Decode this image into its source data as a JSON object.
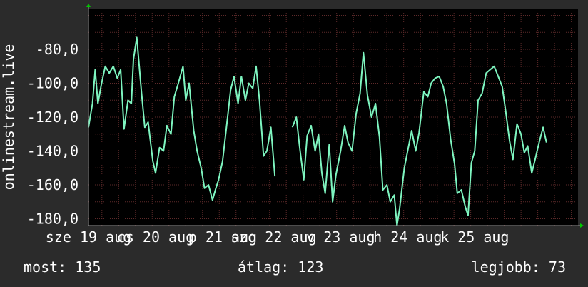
{
  "colors": {
    "background": "#2b2b2b",
    "plot_background": "#000000",
    "line": "#7ef5c0",
    "grid": "#5e2a2a",
    "axis_arrow": "#00c800",
    "text": "#ffffff"
  },
  "footer": {
    "now": "most: 135",
    "average": "átlag: 123",
    "best": "legjobb: 73"
  },
  "chart_data": {
    "type": "line",
    "ylabel": "onlinestream.live",
    "xlabel": "",
    "title": "",
    "ylim": [
      -184,
      -56
    ],
    "xlim": [
      0,
      7.3
    ],
    "grid": true,
    "yticks": [
      {
        "v": -80,
        "label": "-80,0"
      },
      {
        "v": -100,
        "label": "-100,0"
      },
      {
        "v": -120,
        "label": "-120,0"
      },
      {
        "v": -140,
        "label": "-140,0"
      },
      {
        "v": -160,
        "label": "-160,0"
      },
      {
        "v": -180,
        "label": "-180,0"
      }
    ],
    "xtick_labels": [
      {
        "v": 0.0,
        "label": "sze 19 aug"
      },
      {
        "v": 1.0,
        "label": "cs 20 aug"
      },
      {
        "v": 2.0,
        "label": "p 21 aug"
      },
      {
        "v": 2.76,
        "label": "szo 22 aug"
      },
      {
        "v": 3.76,
        "label": "v 23 aug"
      },
      {
        "v": 4.76,
        "label": "h 24 aug"
      },
      {
        "v": 5.76,
        "label": "k 25 aug"
      }
    ],
    "series": [
      {
        "segments": [
          [
            [
              0.0,
              -126
            ],
            [
              0.06,
              -112
            ],
            [
              0.1,
              -92
            ],
            [
              0.14,
              -112
            ],
            [
              0.19,
              -101
            ],
            [
              0.25,
              -90
            ],
            [
              0.31,
              -94
            ],
            [
              0.37,
              -90
            ],
            [
              0.43,
              -97
            ],
            [
              0.48,
              -92
            ],
            [
              0.53,
              -127
            ],
            [
              0.59,
              -110
            ],
            [
              0.64,
              -112
            ],
            [
              0.67,
              -86
            ],
            [
              0.72,
              -73
            ],
            [
              0.79,
              -105
            ],
            [
              0.84,
              -126
            ],
            [
              0.89,
              -123
            ],
            [
              0.96,
              -146
            ],
            [
              1.0,
              -153
            ],
            [
              1.06,
              -138
            ],
            [
              1.12,
              -140
            ],
            [
              1.17,
              -125
            ],
            [
              1.23,
              -130
            ],
            [
              1.28,
              -108
            ],
            [
              1.34,
              -100
            ],
            [
              1.41,
              -90
            ],
            [
              1.45,
              -110
            ],
            [
              1.5,
              -100
            ],
            [
              1.57,
              -128
            ],
            [
              1.62,
              -140
            ],
            [
              1.68,
              -150
            ],
            [
              1.73,
              -162
            ],
            [
              1.79,
              -160
            ],
            [
              1.85,
              -169
            ],
            [
              1.9,
              -162
            ],
            [
              1.94,
              -157
            ],
            [
              2.0,
              -146
            ],
            [
              2.06,
              -125
            ],
            [
              2.12,
              -104
            ],
            [
              2.17,
              -96
            ],
            [
              2.23,
              -112
            ],
            [
              2.28,
              -96
            ],
            [
              2.34,
              -110
            ],
            [
              2.39,
              -100
            ],
            [
              2.45,
              -103
            ],
            [
              2.5,
              -90
            ],
            [
              2.55,
              -110
            ],
            [
              2.61,
              -143
            ],
            [
              2.66,
              -140
            ],
            [
              2.72,
              -126
            ],
            [
              2.78,
              -155
            ]
          ],
          [
            [
              3.04,
              -126
            ],
            [
              3.1,
              -120
            ],
            [
              3.15,
              -138
            ],
            [
              3.21,
              -157
            ],
            [
              3.26,
              -131
            ],
            [
              3.32,
              -125
            ],
            [
              3.38,
              -140
            ],
            [
              3.43,
              -130
            ],
            [
              3.48,
              -153
            ],
            [
              3.53,
              -165
            ],
            [
              3.59,
              -136
            ],
            [
              3.64,
              -170
            ],
            [
              3.69,
              -154
            ],
            [
              3.76,
              -140
            ],
            [
              3.82,
              -125
            ],
            [
              3.87,
              -135
            ],
            [
              3.93,
              -140
            ],
            [
              3.99,
              -118
            ],
            [
              4.05,
              -106
            ],
            [
              4.1,
              -82
            ],
            [
              4.16,
              -107
            ],
            [
              4.22,
              -120
            ],
            [
              4.28,
              -112
            ],
            [
              4.34,
              -132
            ],
            [
              4.39,
              -163
            ],
            [
              4.45,
              -160
            ],
            [
              4.5,
              -170
            ],
            [
              4.56,
              -166
            ],
            [
              4.6,
              -184
            ],
            [
              4.64,
              -174
            ],
            [
              4.71,
              -150
            ],
            [
              4.77,
              -138
            ],
            [
              4.82,
              -128
            ],
            [
              4.88,
              -140
            ],
            [
              4.93,
              -129
            ],
            [
              5.0,
              -105
            ],
            [
              5.06,
              -108
            ],
            [
              5.11,
              -100
            ],
            [
              5.17,
              -97
            ],
            [
              5.23,
              -96
            ],
            [
              5.29,
              -102
            ],
            [
              5.34,
              -112
            ],
            [
              5.4,
              -133
            ],
            [
              5.46,
              -148
            ],
            [
              5.5,
              -165
            ],
            [
              5.56,
              -163
            ],
            [
              5.62,
              -173
            ],
            [
              5.66,
              -178
            ],
            [
              5.71,
              -147
            ],
            [
              5.76,
              -140
            ],
            [
              5.81,
              -110
            ],
            [
              5.87,
              -106
            ],
            [
              5.93,
              -94
            ],
            [
              5.99,
              -92
            ],
            [
              6.05,
              -90
            ],
            [
              6.11,
              -96
            ],
            [
              6.17,
              -102
            ],
            [
              6.22,
              -116
            ],
            [
              6.28,
              -134
            ],
            [
              6.33,
              -145
            ],
            [
              6.39,
              -124
            ],
            [
              6.45,
              -130
            ],
            [
              6.5,
              -141
            ],
            [
              6.55,
              -137
            ],
            [
              6.61,
              -153
            ],
            [
              6.66,
              -145
            ],
            [
              6.72,
              -135
            ],
            [
              6.78,
              -126
            ],
            [
              6.83,
              -135
            ]
          ]
        ]
      }
    ],
    "legend": "none"
  }
}
